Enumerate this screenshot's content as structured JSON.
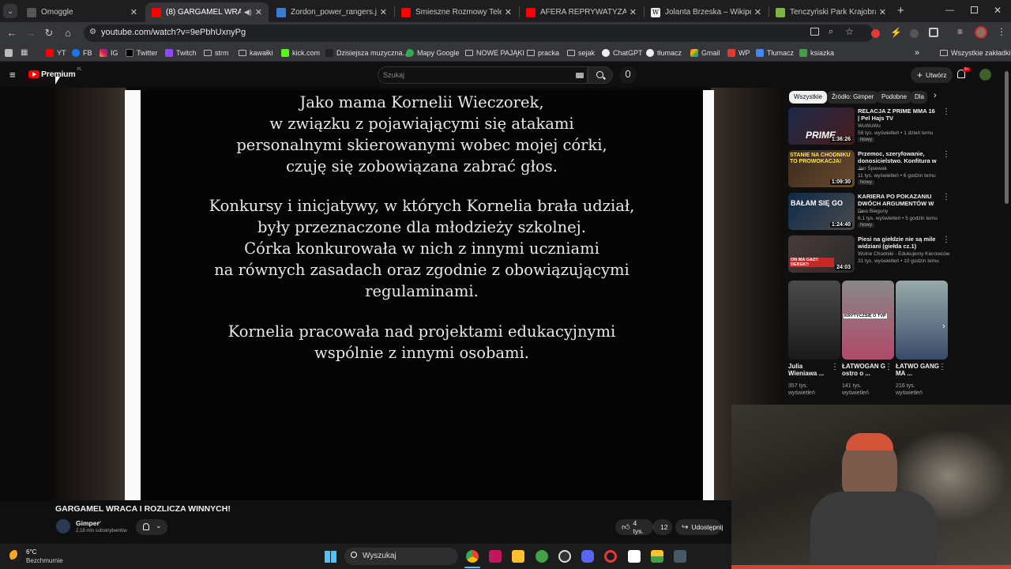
{
  "browser": {
    "tabs": [
      {
        "title": "Omoggle",
        "active": false
      },
      {
        "title": "(8) GARGAMEL WRACA I RO",
        "active": true
      },
      {
        "title": "Zordon_power_rangers.jpg (35",
        "active": false
      },
      {
        "title": "Śmieszne Rozmowy Telefonicz",
        "active": false
      },
      {
        "title": "AFERA REPRYWATYZACYJNA. J",
        "active": false
      },
      {
        "title": "Jolanta Brzeska – Wikipedia, w",
        "active": false
      },
      {
        "title": "Tenczyński Park Krajobrazowy",
        "active": false
      }
    ],
    "new_tab": "+",
    "url": "youtube.com/watch?v=9ePbhUxnyPg",
    "bookmarks": [
      "YT",
      "FB",
      "IG",
      "Twitter",
      "Twitch",
      "strm",
      "kawałki",
      "kick.com",
      "Dzisiejsza muzyczna...",
      "Mapy Google",
      "NOWE PAJĄKI",
      "pracka",
      "sejak",
      "ChatGPT",
      "tłumacz",
      "Gmail",
      "WP",
      "Tłumacz",
      "ksiazka"
    ],
    "all_bookmarks": "Wszystkie zakładki",
    "more": "»"
  },
  "youtube": {
    "logo": "Premium",
    "logo_sup": "PL",
    "search_placeholder": "Szukaj",
    "create": "Utwórz",
    "notif_count": "9+"
  },
  "video": {
    "paragraphs": [
      [
        "Jako mama Kornelii Wieczorek,",
        "w związku z pojawiającymi się atakami",
        "personalnymi skierowanymi wobec mojej córki,",
        "czuję się zobowiązana zabrać głos."
      ],
      [
        "Konkursy i inicjatywy, w których Kornelia brała udział,",
        "były przeznaczone dla młodzieży szkolnej.",
        "Córka konkurowała w nich z innymi uczniami",
        "na równych zasadach oraz zgodnie z obowiązującymi",
        "regulaminami."
      ],
      [
        "Kornelia pracowała nad projektami edukacyjnymi",
        "wspólnie z innymi osobami."
      ]
    ],
    "title": "GARGAMEL WRACA I ROZLICZA WINNYCH!",
    "channel": "Gimper",
    "subscribers": "2,18 mln subskrybentów",
    "likes": "4 tys.",
    "comments": "12",
    "share": "Udostępnij"
  },
  "sidebar": {
    "chips": [
      "Wszystkie",
      "Źródło: Gimper",
      "Podobne",
      "Dla"
    ],
    "recommendations": [
      {
        "title": "RELACJA Z PRIME MMA 16 | Pel Hajs TV",
        "channel": "WuWuWu",
        "meta": "58 tys. wyświetleń • 1 dzień temu",
        "badge": "Nowy",
        "duration": "1:36:26",
        "thumb_text": "PRIME"
      },
      {
        "title": "Przemoc, szeryfowanie, donosicielstwo. Konfitura w ...",
        "channel": "Jan Śpiewak",
        "meta": "11 tys. wyświetleń • 6 godzin temu",
        "badge": "Nowy",
        "duration": "1:09:30",
        "thumb_text": "STANIE NA CHODNIKU TO PROWOKACJA!"
      },
      {
        "title": "KARIERA PO POKAZANIU DWÓCH ARGUMENTÓW W ...",
        "channel": "Dwa Bieguny",
        "meta": "6,1 tys. wyświetleń • 5 godzin temu",
        "badge": "Nowy",
        "duration": "1:24:40",
        "thumb_text": "BAŁAM SIĘ GO"
      },
      {
        "title": "Piesi na giełdzie nie są mile widziani (giełda cz.1)",
        "channel": "Wolne Chodniki - Edukujemy Kierowców",
        "meta": "31 tys. wyświetleń • 10 godzin temu",
        "badge": "Nowy",
        "duration": "24:03",
        "thumb_text": "ON MA GAZ!! DEBEK!!"
      }
    ],
    "shorts": [
      {
        "title": "Julia Wieniawa ...",
        "views": "357 tys. wyświetleń"
      },
      {
        "title": "ŁATWOGAN G ostro o ...",
        "views": "141 tys. wyświetleń",
        "thumb_text": "KRYTYCZSIĘ O TVP"
      },
      {
        "title": "ŁATWO GANG MA ...",
        "views": "216 tys. wyświetleń"
      }
    ]
  },
  "taskbar": {
    "temp": "6°C",
    "weather": "Bezchmurnie",
    "search": "Wyszukaj"
  }
}
